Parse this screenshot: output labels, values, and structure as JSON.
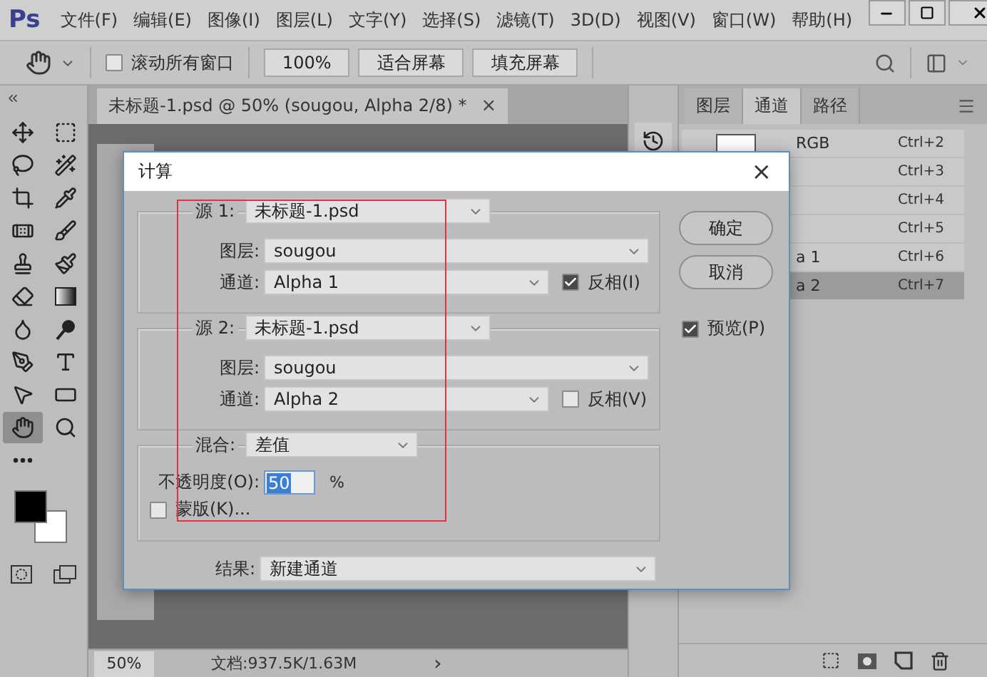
{
  "menubar": {
    "logo": "Ps",
    "items": [
      "文件(F)",
      "编辑(E)",
      "图像(I)",
      "图层(L)",
      "文字(Y)",
      "选择(S)",
      "滤镜(T)",
      "3D(D)",
      "视图(V)",
      "窗口(W)",
      "帮助(H)"
    ]
  },
  "options_bar": {
    "scroll_all": {
      "label": "滚动所有窗口",
      "checked": false
    },
    "buttons": [
      "100%",
      "适合屏幕",
      "填充屏幕"
    ]
  },
  "tools": [
    {
      "kind": "move",
      "selected": false
    },
    {
      "kind": "marquee",
      "selected": false
    },
    {
      "kind": "lasso",
      "selected": false
    },
    {
      "kind": "wand",
      "selected": false
    },
    {
      "kind": "crop",
      "selected": false
    },
    {
      "kind": "eyedropper",
      "selected": false
    },
    {
      "kind": "healing",
      "selected": false
    },
    {
      "kind": "brush",
      "selected": false
    },
    {
      "kind": "stamp",
      "selected": false
    },
    {
      "kind": "history_brush",
      "selected": false
    },
    {
      "kind": "eraser",
      "selected": false
    },
    {
      "kind": "gradient",
      "selected": false
    },
    {
      "kind": "blur",
      "selected": false
    },
    {
      "kind": "dodge",
      "selected": false
    },
    {
      "kind": "pen",
      "selected": false
    },
    {
      "kind": "type",
      "selected": false
    },
    {
      "kind": "path_select",
      "selected": false
    },
    {
      "kind": "shape",
      "selected": false
    },
    {
      "kind": "hand",
      "selected": true
    },
    {
      "kind": "zoom",
      "selected": false
    },
    {
      "kind": "more",
      "selected": false
    }
  ],
  "document": {
    "tab": {
      "title": "未标题-1.psd @ 50% (sougou, Alpha 2/8) *",
      "close": "×"
    },
    "status": {
      "zoom": "50%",
      "info": "文档:937.5K/1.63M",
      "arrow": "›"
    }
  },
  "channels_panel": {
    "tabs": [
      {
        "label": "图层",
        "selected": false
      },
      {
        "label": "通道",
        "selected": true
      },
      {
        "label": "路径",
        "selected": false
      }
    ],
    "rows": [
      {
        "name": "RGB",
        "shortcut": "Ctrl+2",
        "selected": false
      },
      {
        "shortcut": "Ctrl+3",
        "selected": false
      },
      {
        "shortcut": "Ctrl+4",
        "selected": false
      },
      {
        "shortcut": "Ctrl+5",
        "selected": false
      },
      {
        "name": "a 1",
        "shortcut": "Ctrl+6",
        "selected": false
      },
      {
        "name": "a 2",
        "shortcut": "Ctrl+7",
        "selected": true
      }
    ]
  },
  "dialog": {
    "title": "计算",
    "close": "×",
    "sources": [
      {
        "label": "源 1:",
        "file": "未标题-1.psd",
        "layer_label": "图层:",
        "layer": "sougou",
        "channel_label": "通道:",
        "channel": "Alpha 1",
        "invert": {
          "label": "反相(I)",
          "checked": true
        }
      },
      {
        "label": "源 2:",
        "file": "未标题-1.psd",
        "layer_label": "图层:",
        "layer": "sougou",
        "channel_label": "通道:",
        "channel": "Alpha 2",
        "invert": {
          "label": "反相(V)",
          "checked": false
        }
      }
    ],
    "blending": {
      "label": "混合:",
      "mode": "差值",
      "opacity_label": "不透明度(O):",
      "opacity": "50",
      "unit": "%",
      "mask": {
        "label": "蒙版(K)...",
        "checked": false
      }
    },
    "result": {
      "label": "结果:",
      "value": "新建通道"
    },
    "buttons": [
      "确定",
      "取消"
    ],
    "preview": {
      "label": "预览(P)",
      "checked": true
    }
  }
}
